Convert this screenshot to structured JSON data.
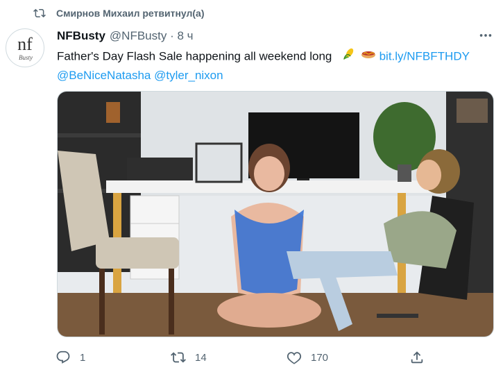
{
  "retweet": {
    "icon": "retweet-icon",
    "text": "Смирнов Михаил ретвитнул(а)"
  },
  "tweet": {
    "avatar_text": "nf",
    "avatar_sub": "Busty",
    "author_name": "NFBusty",
    "handle_time": "@NFBusty · 8 ч",
    "text_line1": "Father's Day Flash Sale happening all weekend long",
    "emojis": [
      "corn-emoji",
      "hotdog-emoji"
    ],
    "link": "bit.ly/NFBFTHDY",
    "mention1": "@BeNiceNatasha",
    "mention2": "@tyler_nixon",
    "media_icon": "promo-photo"
  },
  "actions": {
    "reply": {
      "icon": "reply-icon",
      "count": "1"
    },
    "retweet": {
      "icon": "retweet-icon",
      "count": "14"
    },
    "like": {
      "icon": "heart-icon",
      "count": "170"
    },
    "share": {
      "icon": "share-icon"
    }
  },
  "colors": {
    "accent": "#1d9bf0",
    "muted": "#536471",
    "text": "#0f1419"
  }
}
